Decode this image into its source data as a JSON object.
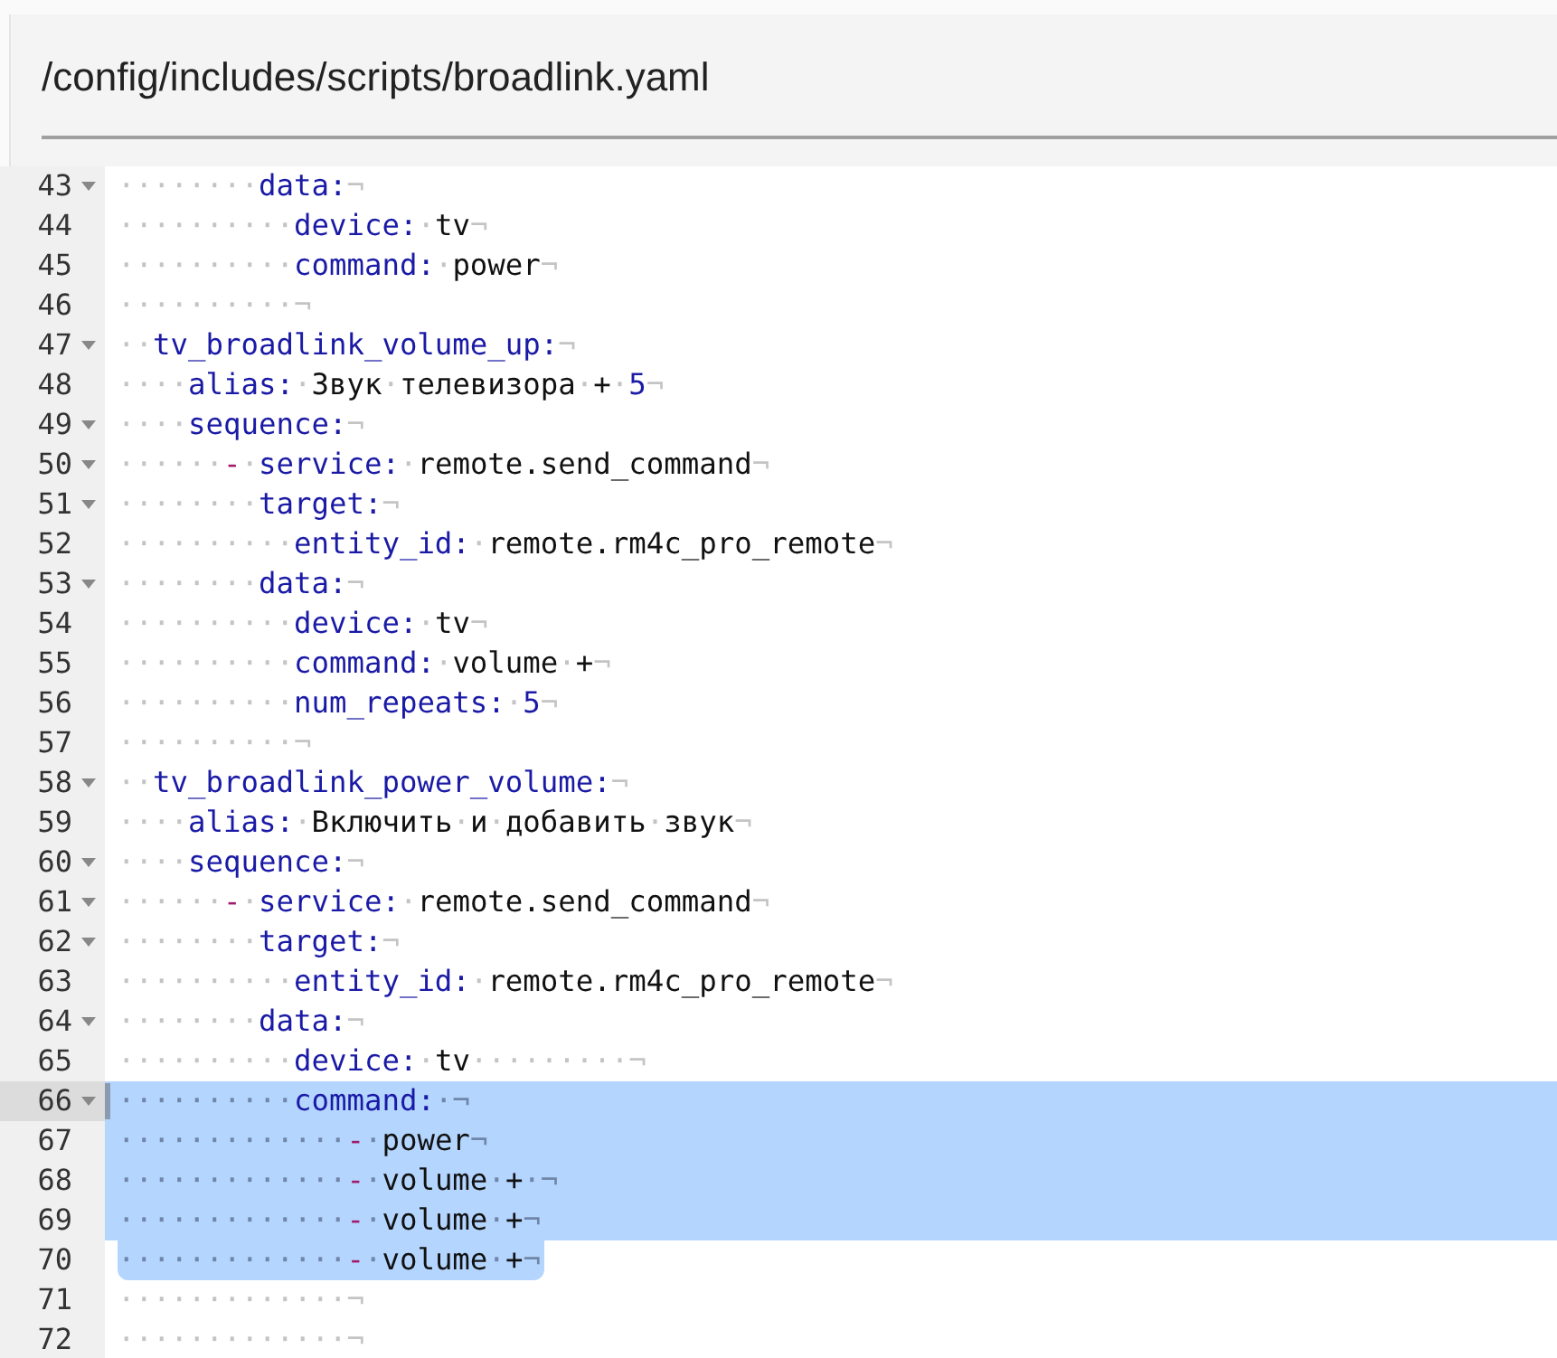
{
  "title": "/config/includes/scripts/broadlink.yaml",
  "lines": [
    {
      "number": "43",
      "foldable": true,
      "selected": false,
      "tokens": [
        {
          "kind": "ws",
          "text": "········"
        },
        {
          "kind": "key",
          "text": "data:"
        },
        {
          "kind": "ws",
          "text": "¬"
        }
      ]
    },
    {
      "number": "44",
      "foldable": false,
      "selected": false,
      "tokens": [
        {
          "kind": "ws",
          "text": "··········"
        },
        {
          "kind": "key",
          "text": "device:"
        },
        {
          "kind": "ws",
          "text": "·"
        },
        {
          "kind": "value",
          "text": "tv"
        },
        {
          "kind": "ws",
          "text": "¬"
        }
      ]
    },
    {
      "number": "45",
      "foldable": false,
      "selected": false,
      "tokens": [
        {
          "kind": "ws",
          "text": "··········"
        },
        {
          "kind": "key",
          "text": "command:"
        },
        {
          "kind": "ws",
          "text": "·"
        },
        {
          "kind": "value",
          "text": "power"
        },
        {
          "kind": "ws",
          "text": "¬"
        }
      ]
    },
    {
      "number": "46",
      "foldable": false,
      "selected": false,
      "tokens": [
        {
          "kind": "ws",
          "text": "··········¬"
        }
      ]
    },
    {
      "number": "47",
      "foldable": true,
      "selected": false,
      "tokens": [
        {
          "kind": "ws",
          "text": "··"
        },
        {
          "kind": "key",
          "text": "tv_broadlink_volume_up:"
        },
        {
          "kind": "ws",
          "text": "¬"
        }
      ]
    },
    {
      "number": "48",
      "foldable": false,
      "selected": false,
      "tokens": [
        {
          "kind": "ws",
          "text": "····"
        },
        {
          "kind": "key",
          "text": "alias:"
        },
        {
          "kind": "ws",
          "text": "·"
        },
        {
          "kind": "value",
          "text": "Звук"
        },
        {
          "kind": "ws",
          "text": "·"
        },
        {
          "kind": "value",
          "text": "телевизора"
        },
        {
          "kind": "ws",
          "text": "·"
        },
        {
          "kind": "value",
          "text": "+"
        },
        {
          "kind": "ws",
          "text": "·"
        },
        {
          "kind": "number",
          "text": "5"
        },
        {
          "kind": "ws",
          "text": "¬"
        }
      ]
    },
    {
      "number": "49",
      "foldable": true,
      "selected": false,
      "tokens": [
        {
          "kind": "ws",
          "text": "····"
        },
        {
          "kind": "key",
          "text": "sequence:"
        },
        {
          "kind": "ws",
          "text": "¬"
        }
      ]
    },
    {
      "number": "50",
      "foldable": true,
      "selected": false,
      "tokens": [
        {
          "kind": "ws",
          "text": "······"
        },
        {
          "kind": "dash",
          "text": "-"
        },
        {
          "kind": "ws",
          "text": "·"
        },
        {
          "kind": "key",
          "text": "service:"
        },
        {
          "kind": "ws",
          "text": "·"
        },
        {
          "kind": "value",
          "text": "remote.send_command"
        },
        {
          "kind": "ws",
          "text": "¬"
        }
      ]
    },
    {
      "number": "51",
      "foldable": true,
      "selected": false,
      "tokens": [
        {
          "kind": "ws",
          "text": "········"
        },
        {
          "kind": "key",
          "text": "target:"
        },
        {
          "kind": "ws",
          "text": "¬"
        }
      ]
    },
    {
      "number": "52",
      "foldable": false,
      "selected": false,
      "tokens": [
        {
          "kind": "ws",
          "text": "··········"
        },
        {
          "kind": "key",
          "text": "entity_id:"
        },
        {
          "kind": "ws",
          "text": "·"
        },
        {
          "kind": "value",
          "text": "remote.rm4c_pro_remote"
        },
        {
          "kind": "ws",
          "text": "¬"
        }
      ]
    },
    {
      "number": "53",
      "foldable": true,
      "selected": false,
      "tokens": [
        {
          "kind": "ws",
          "text": "········"
        },
        {
          "kind": "key",
          "text": "data:"
        },
        {
          "kind": "ws",
          "text": "¬"
        }
      ]
    },
    {
      "number": "54",
      "foldable": false,
      "selected": false,
      "tokens": [
        {
          "kind": "ws",
          "text": "··········"
        },
        {
          "kind": "key",
          "text": "device:"
        },
        {
          "kind": "ws",
          "text": "·"
        },
        {
          "kind": "value",
          "text": "tv"
        },
        {
          "kind": "ws",
          "text": "¬"
        }
      ]
    },
    {
      "number": "55",
      "foldable": false,
      "selected": false,
      "tokens": [
        {
          "kind": "ws",
          "text": "··········"
        },
        {
          "kind": "key",
          "text": "command:"
        },
        {
          "kind": "ws",
          "text": "·"
        },
        {
          "kind": "value",
          "text": "volume"
        },
        {
          "kind": "ws",
          "text": "·"
        },
        {
          "kind": "value",
          "text": "+"
        },
        {
          "kind": "ws",
          "text": "¬"
        }
      ]
    },
    {
      "number": "56",
      "foldable": false,
      "selected": false,
      "tokens": [
        {
          "kind": "ws",
          "text": "··········"
        },
        {
          "kind": "key",
          "text": "num_repeats:"
        },
        {
          "kind": "ws",
          "text": "·"
        },
        {
          "kind": "number",
          "text": "5"
        },
        {
          "kind": "ws",
          "text": "¬"
        }
      ]
    },
    {
      "number": "57",
      "foldable": false,
      "selected": false,
      "tokens": [
        {
          "kind": "ws",
          "text": "··········¬"
        }
      ]
    },
    {
      "number": "58",
      "foldable": true,
      "selected": false,
      "tokens": [
        {
          "kind": "ws",
          "text": "··"
        },
        {
          "kind": "key",
          "text": "tv_broadlink_power_volume:"
        },
        {
          "kind": "ws",
          "text": "¬"
        }
      ]
    },
    {
      "number": "59",
      "foldable": false,
      "selected": false,
      "tokens": [
        {
          "kind": "ws",
          "text": "····"
        },
        {
          "kind": "key",
          "text": "alias:"
        },
        {
          "kind": "ws",
          "text": "·"
        },
        {
          "kind": "value",
          "text": "Включить"
        },
        {
          "kind": "ws",
          "text": "·"
        },
        {
          "kind": "value",
          "text": "и"
        },
        {
          "kind": "ws",
          "text": "·"
        },
        {
          "kind": "value",
          "text": "добавить"
        },
        {
          "kind": "ws",
          "text": "·"
        },
        {
          "kind": "value",
          "text": "звук"
        },
        {
          "kind": "ws",
          "text": "¬"
        }
      ]
    },
    {
      "number": "60",
      "foldable": true,
      "selected": false,
      "tokens": [
        {
          "kind": "ws",
          "text": "····"
        },
        {
          "kind": "key",
          "text": "sequence:"
        },
        {
          "kind": "ws",
          "text": "¬"
        }
      ]
    },
    {
      "number": "61",
      "foldable": true,
      "selected": false,
      "tokens": [
        {
          "kind": "ws",
          "text": "······"
        },
        {
          "kind": "dash",
          "text": "-"
        },
        {
          "kind": "ws",
          "text": "·"
        },
        {
          "kind": "key",
          "text": "service:"
        },
        {
          "kind": "ws",
          "text": "·"
        },
        {
          "kind": "value",
          "text": "remote.send_command"
        },
        {
          "kind": "ws",
          "text": "¬"
        }
      ]
    },
    {
      "number": "62",
      "foldable": true,
      "selected": false,
      "tokens": [
        {
          "kind": "ws",
          "text": "········"
        },
        {
          "kind": "key",
          "text": "target:"
        },
        {
          "kind": "ws",
          "text": "¬"
        }
      ]
    },
    {
      "number": "63",
      "foldable": false,
      "selected": false,
      "tokens": [
        {
          "kind": "ws",
          "text": "··········"
        },
        {
          "kind": "key",
          "text": "entity_id:"
        },
        {
          "kind": "ws",
          "text": "·"
        },
        {
          "kind": "value",
          "text": "remote.rm4c_pro_remote"
        },
        {
          "kind": "ws",
          "text": "¬"
        }
      ]
    },
    {
      "number": "64",
      "foldable": true,
      "selected": false,
      "tokens": [
        {
          "kind": "ws",
          "text": "········"
        },
        {
          "kind": "key",
          "text": "data:"
        },
        {
          "kind": "ws",
          "text": "¬"
        }
      ]
    },
    {
      "number": "65",
      "foldable": false,
      "selected": false,
      "tokens": [
        {
          "kind": "ws",
          "text": "··········"
        },
        {
          "kind": "key",
          "text": "device:"
        },
        {
          "kind": "ws",
          "text": "·"
        },
        {
          "kind": "value",
          "text": "tv"
        },
        {
          "kind": "ws",
          "text": "·········¬"
        }
      ]
    },
    {
      "number": "66",
      "foldable": true,
      "selected": true,
      "active": true,
      "tokens": [
        {
          "kind": "ws",
          "text": "··········"
        },
        {
          "kind": "key",
          "text": "command:"
        },
        {
          "kind": "ws",
          "text": "·¬"
        }
      ]
    },
    {
      "number": "67",
      "foldable": false,
      "selected": true,
      "tokens": [
        {
          "kind": "ws",
          "text": "·············"
        },
        {
          "kind": "dash",
          "text": "-"
        },
        {
          "kind": "ws",
          "text": "·"
        },
        {
          "kind": "value",
          "text": "power"
        },
        {
          "kind": "ws",
          "text": "¬"
        }
      ]
    },
    {
      "number": "68",
      "foldable": false,
      "selected": true,
      "tokens": [
        {
          "kind": "ws",
          "text": "·············"
        },
        {
          "kind": "dash",
          "text": "-"
        },
        {
          "kind": "ws",
          "text": "·"
        },
        {
          "kind": "value",
          "text": "volume"
        },
        {
          "kind": "ws",
          "text": "·"
        },
        {
          "kind": "value",
          "text": "+"
        },
        {
          "kind": "ws",
          "text": "·¬"
        }
      ]
    },
    {
      "number": "69",
      "foldable": false,
      "selected": true,
      "tokens": [
        {
          "kind": "ws",
          "text": "·············"
        },
        {
          "kind": "dash",
          "text": "-"
        },
        {
          "kind": "ws",
          "text": "·"
        },
        {
          "kind": "value",
          "text": "volume"
        },
        {
          "kind": "ws",
          "text": "·"
        },
        {
          "kind": "value",
          "text": "+"
        },
        {
          "kind": "ws",
          "text": "¬"
        }
      ]
    },
    {
      "number": "70",
      "foldable": false,
      "selected": true,
      "partial": true,
      "tokens": [
        {
          "kind": "ws",
          "text": "·············"
        },
        {
          "kind": "dash",
          "text": "-"
        },
        {
          "kind": "ws",
          "text": "·"
        },
        {
          "kind": "value",
          "text": "volume"
        },
        {
          "kind": "ws",
          "text": "·"
        },
        {
          "kind": "value",
          "text": "+"
        },
        {
          "kind": "ws",
          "text": "¬"
        }
      ]
    },
    {
      "number": "71",
      "foldable": false,
      "selected": false,
      "tokens": [
        {
          "kind": "ws",
          "text": "·············¬"
        }
      ]
    },
    {
      "number": "72",
      "foldable": false,
      "selected": false,
      "tokens": [
        {
          "kind": "ws",
          "text": "·············¬"
        }
      ]
    }
  ]
}
